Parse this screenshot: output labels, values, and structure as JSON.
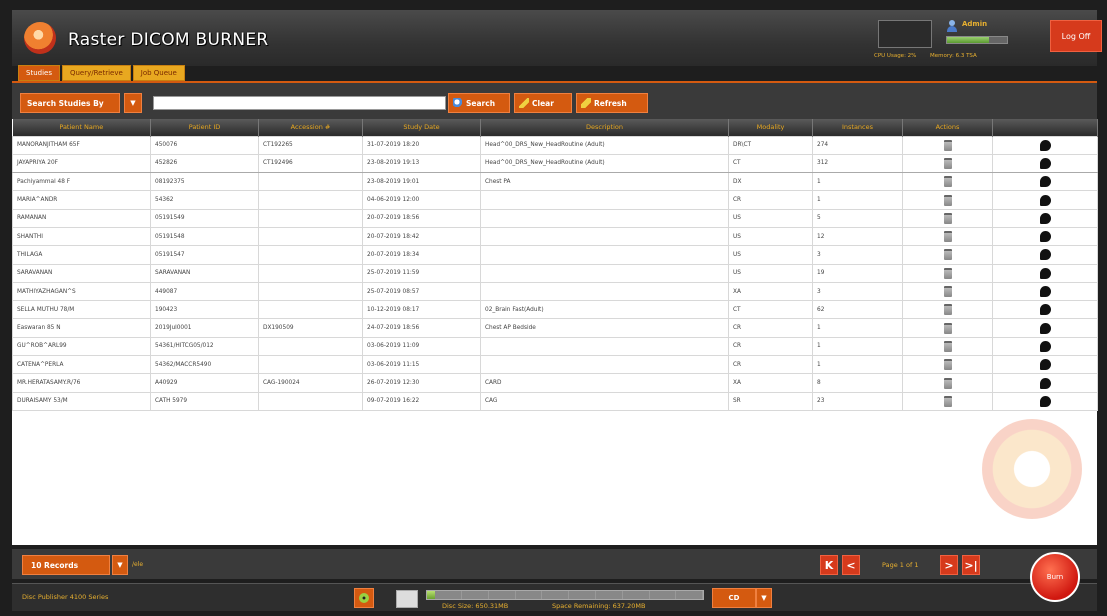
{
  "app": {
    "title": "Raster DICOM BURNER",
    "cpu_label": "CPU Usage: 2%",
    "memory_label": "Memory: 6.3 TSA",
    "memory_fraction": 0.7,
    "user": "Admin",
    "logoff": "Log Off"
  },
  "tabs": [
    "Studies",
    "Query/Retrieve",
    "Job Queue"
  ],
  "search": {
    "by_label": "Search Studies By",
    "value": "",
    "search_btn": "Search",
    "clear_btn": "Clear",
    "refresh_btn": "Refresh"
  },
  "table": {
    "columns": [
      "Patient Name",
      "Patient ID",
      "Accession #",
      "Study Date",
      "Description",
      "Modality",
      "Instances",
      "Actions",
      ""
    ],
    "rows": [
      [
        "MANORANJITHAM 65F",
        "450076",
        "CT192265",
        "31-07-2019 18:20",
        "Head^00_DRS_New_HeadRoutine (Adult)",
        "DR\\CT",
        "274"
      ],
      [
        "JAYAPRIYA 20F",
        "452826",
        "CT192496",
        "23-08-2019 19:13",
        "Head^00_DRS_New_HeadRoutine (Adult)",
        "CT",
        "312"
      ],
      [
        "Pachiyammal 48 F",
        "08192375",
        "",
        "23-08-2019 19:01",
        "Chest PA",
        "DX",
        "1"
      ],
      [
        "MARIA^ANDR",
        "54362",
        "",
        "04-06-2019 12:00",
        "",
        "CR",
        "1"
      ],
      [
        "RAMANAN",
        "05191549",
        "",
        "20-07-2019 18:56",
        "",
        "US",
        "5"
      ],
      [
        "SHANTHI",
        "05191548",
        "",
        "20-07-2019 18:42",
        "",
        "US",
        "12"
      ],
      [
        "THILAGA",
        "05191547",
        "",
        "20-07-2019 18:34",
        "",
        "US",
        "3"
      ],
      [
        "SARAVANAN",
        "SARAVANAN",
        "",
        "25-07-2019 11:59",
        "",
        "US",
        "19"
      ],
      [
        "MATHIYAZHAGAN^S",
        "449087",
        "",
        "25-07-2019 08:57",
        "",
        "XA",
        "3"
      ],
      [
        "SELLA MUTHU 78/M",
        "190423",
        "",
        "10-12-2019 08:17",
        "02_Brain Fast(Adult)",
        "CT",
        "62"
      ],
      [
        "Easwaran 85 N",
        "2019Jul0001",
        "DX190509",
        "24-07-2019 18:56",
        "Chest AP Bedside",
        "CR",
        "1"
      ],
      [
        "GU^ROB^ARL99",
        "54361/HITCG05/012",
        "",
        "03-06-2019 11:09",
        "",
        "CR",
        "1"
      ],
      [
        "CATENA^PERLA",
        "54362/MACCR5490",
        "",
        "03-06-2019 11:15",
        "",
        "CR",
        "1"
      ],
      [
        "MR.HERATASAMY.R/76",
        "A40929",
        "CAG-190024",
        "26-07-2019 12:30",
        "CARD",
        "XA",
        "8"
      ],
      [
        "DURAISAMY 53/M",
        "CATH 5979",
        "",
        "09-07-2019 16:22",
        "CAG",
        "SR",
        "23"
      ]
    ]
  },
  "pager": {
    "records_btn": "10 Records",
    "records_label": "/ele",
    "page_info": "Page 1 of 1",
    "first": "K",
    "prev": "<",
    "next": ">",
    "last": ">|"
  },
  "status": {
    "publisher": "Disc Publisher 4100 Series",
    "disc_size": "Disc Size: 650.31MB",
    "space_remaining": "Space Remaining: 637.20MB",
    "disc_fraction": 0.03,
    "media": "CD",
    "burn": "Burn"
  },
  "colors": {
    "accent": "#d45a10",
    "brand_gold": "#e8a820",
    "danger": "#d63a1c"
  }
}
